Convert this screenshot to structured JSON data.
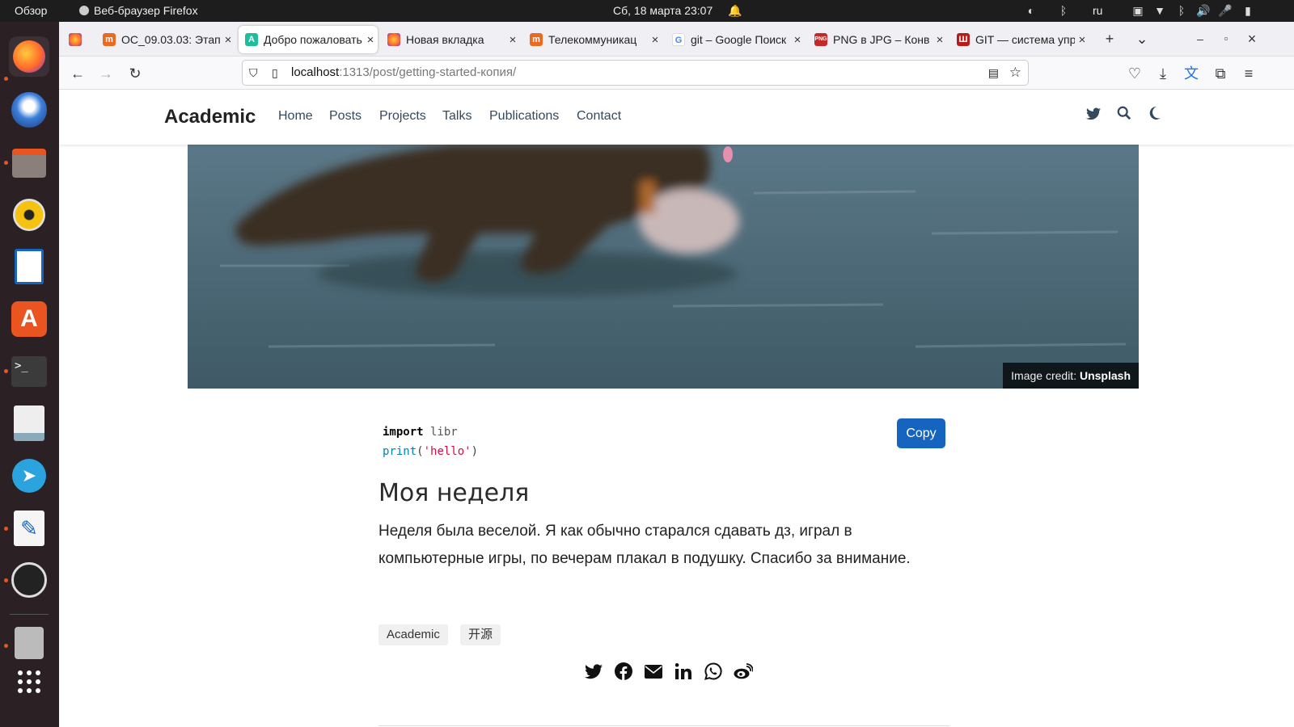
{
  "topbar": {
    "overview": "Обзор",
    "app": "Веб-браузер Firefox",
    "datetime": "Сб, 18 марта  23:07",
    "lang": "ru"
  },
  "tabs": [
    {
      "title": "ОС_09.03.03: Этап",
      "fav": "tn"
    },
    {
      "title": "Добро пожаловать",
      "fav": "academic",
      "active": true
    },
    {
      "title": "Новая вкладка",
      "fav": "firefox"
    },
    {
      "title": "Телекоммуникац",
      "fav": "tn"
    },
    {
      "title": "git – Google Поиск",
      "fav": "google"
    },
    {
      "title": "PNG в JPG – Конв",
      "fav": "png"
    },
    {
      "title": "GIT — система упр",
      "fav": "w"
    }
  ],
  "url": {
    "host": "localhost",
    "rest": ":1313/post/getting-started-копия/"
  },
  "site": {
    "brand": "Academic",
    "menu": [
      "Home",
      "Posts",
      "Projects",
      "Talks",
      "Publications",
      "Contact"
    ]
  },
  "hero": {
    "credit_label": "Image credit: ",
    "credit_source": "Unsplash"
  },
  "code": {
    "kw": "import",
    "mod": " libr",
    "fn": "print",
    "open": "(",
    "str": "'hello'",
    "close": ")"
  },
  "copy_label": "Copy",
  "heading": "Моя неделя",
  "paragraph": "Неделя была веселой. Я как обычно старался сдавать дз, играл в компьютерные игры, по вечерам плакал в подушку. Спасибо за внимание.",
  "tags": [
    "Academic",
    "开源"
  ],
  "colors": {
    "primary": "#1565c0",
    "accent_orange": "#e95420"
  }
}
